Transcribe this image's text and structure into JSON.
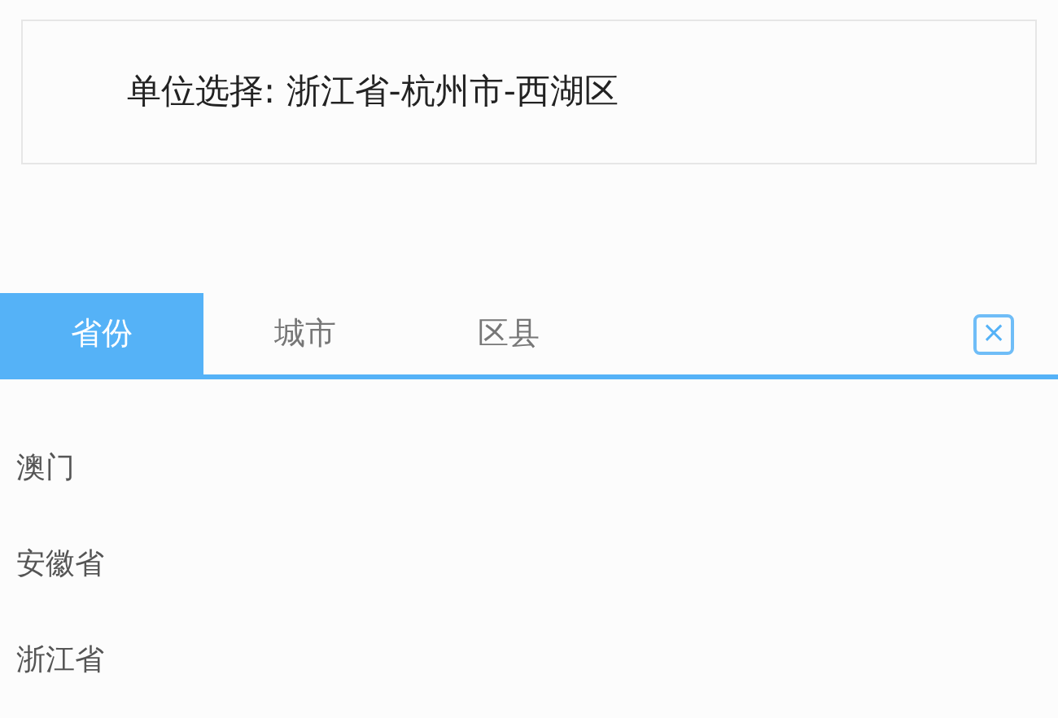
{
  "selection": {
    "label": "单位选择:",
    "value": "浙江省-杭州市-西湖区"
  },
  "tabs": [
    {
      "label": "省份",
      "selected": true
    },
    {
      "label": "城市",
      "selected": false
    },
    {
      "label": "区县",
      "selected": false
    }
  ],
  "close_button": {
    "label": "×"
  },
  "items": [
    {
      "label": "澳门"
    },
    {
      "label": "安徽省"
    },
    {
      "label": "浙江省"
    }
  ]
}
